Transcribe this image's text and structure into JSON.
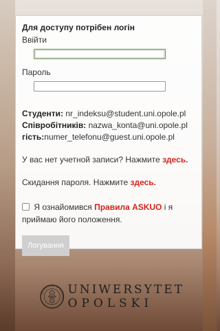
{
  "login": {
    "heading": "Для доступу потрібен логін",
    "username_label": "Ввійти",
    "username_value": "",
    "password_label": "Пароль",
    "password_value": "",
    "students_label": "Студенти:",
    "students_value": " nr_indeksu@student.uni.opole.pl",
    "staff_label": "Співробітників:",
    "staff_value": " nazwa_konta@uni.opole.pl",
    "guest_label": "гість:",
    "guest_value": "numer_telefonu@guest.uni.opole.pl",
    "no_account_text": "У вас нет учетной записи? Нажмите ",
    "no_account_link": "здесь.",
    "reset_text": "Скидання пароля. Нажмите ",
    "reset_link": "здесь.",
    "agree_prefix": "Я ознайомився ",
    "agree_link": "Правила ASKUO",
    "agree_suffix": " і я приймаю його положення.",
    "agree_checked": false,
    "submit_label": "Логування"
  },
  "branding": {
    "line1": "UNIWERSYTET",
    "line2": "OPOLSKI",
    "seal_text": "UNIVERSITAS OPOLIENSIS"
  }
}
